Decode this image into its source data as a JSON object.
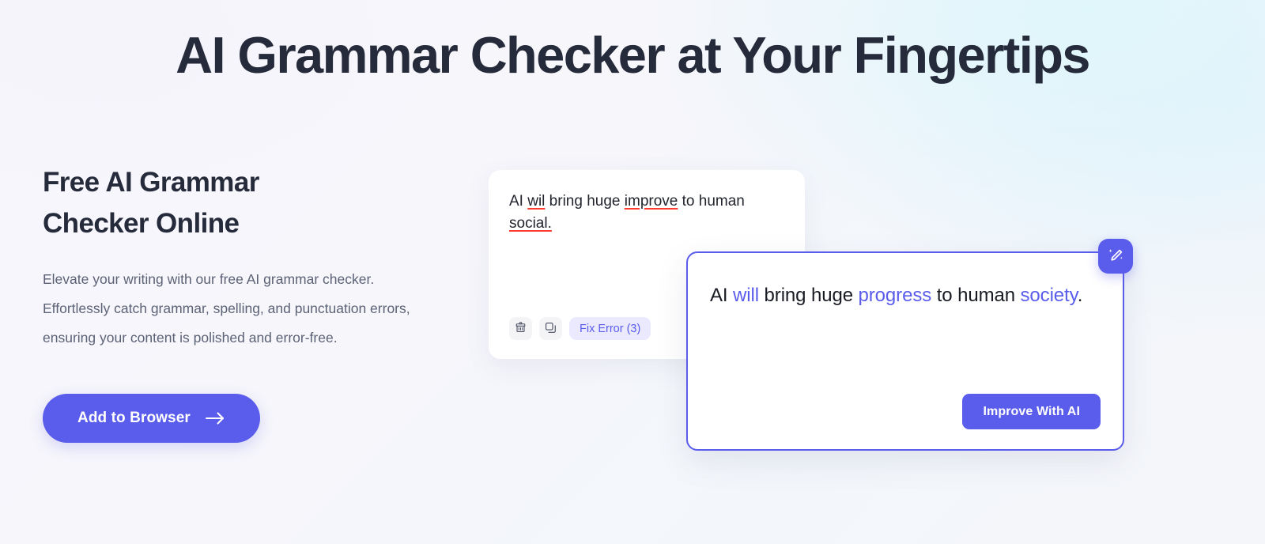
{
  "hero": {
    "title": "AI Grammar Checker at Your Fingertips"
  },
  "left": {
    "heading_line1": "Free AI Grammar",
    "heading_line2": "Checker Online",
    "description": "Elevate your writing with our free AI grammar checker. Effortlessly catch grammar, spelling, and punctuation errors, ensuring your content is polished and error-free.",
    "cta_label": "Add to Browser",
    "cta_icon": "arrow-right-icon"
  },
  "editor_card": {
    "text_parts": {
      "p1": "AI ",
      "error1": "wil",
      "p2": " bring huge ",
      "error2": "improve",
      "p3": " to human ",
      "error3": "social."
    },
    "full_text": "AI wil bring huge improve to human social.",
    "toolbar": {
      "clean_icon": "brush-icon",
      "copy_icon": "copy-icon",
      "fix_error_label": "Fix Error (3)",
      "error_count": 3
    },
    "error_underline_color": "#ff3b30"
  },
  "suggestion_card": {
    "text_parts": {
      "p1": "AI ",
      "hl1": "will",
      "p2": " bring huge ",
      "hl2": "progress",
      "p3": " to human ",
      "hl3": "society",
      "p4": "."
    },
    "full_text": "AI will bring huge progress to human society.",
    "improve_label": "Improve With AI",
    "badge_icon": "magic-pencil-icon",
    "accent_color": "#5a5ceb",
    "highlight_color": "#5a5ceb"
  },
  "theme": {
    "accent": "#5a5ceb",
    "title_color": "#252b3b",
    "body_text_color": "#5c6276",
    "error_color": "#ff3b30",
    "chip_bg": "#ebe9fd",
    "card_bg": "#ffffff"
  }
}
